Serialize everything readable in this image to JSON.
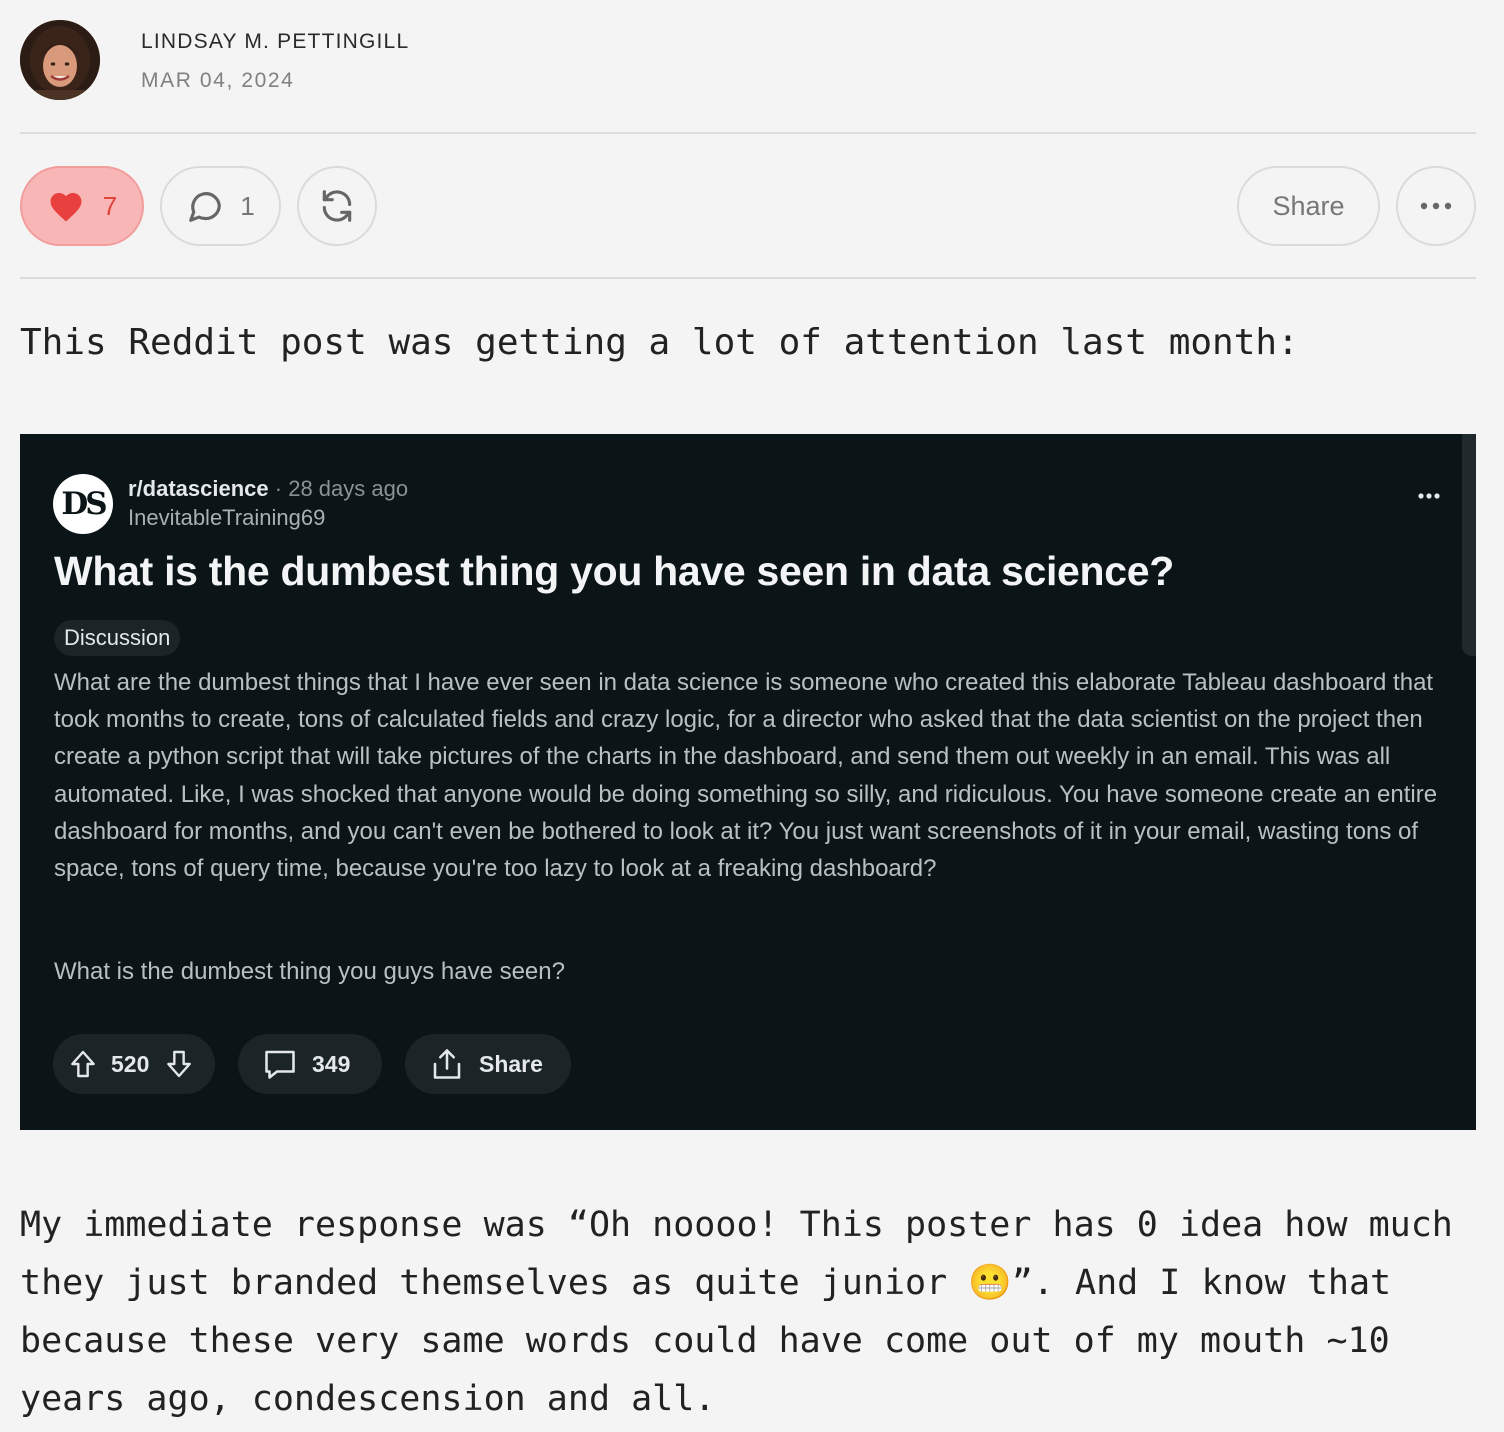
{
  "post": {
    "author": "LINDSAY M. PETTINGILL",
    "date": "MAR 04, 2024"
  },
  "actions": {
    "like_count": "7",
    "comment_count": "1",
    "share_label": "Share",
    "like_color": "#e0453c"
  },
  "content": {
    "intro": "This Reddit post was getting a lot of attention last month:",
    "response": "My immediate response was “Oh noooo! This poster has 0 idea how much they just branded themselves as quite junior 😬”. And I know that because these very same words could have come out of my mouth ~10 years ago, condescension and all."
  },
  "reddit": {
    "logo_text": "DS",
    "subreddit": "r/datascience",
    "separator": "·",
    "age": "28 days ago",
    "username": "InevitableTraining69",
    "title": "What is the dumbest thing you have seen in data science?",
    "flair": "Discussion",
    "body": "What are the dumbest things that I have ever seen in data science is someone who created this elaborate Tableau dashboard that took months to create, tons of calculated fields and crazy logic, for a director who asked that the data scientist on the project then create a python script that will take pictures of the charts in the dashboard, and send them out weekly in an email. This was all automated. Like, I was shocked that anyone would be doing something so silly, and ridiculous. You have someone create an entire dashboard for months, and you can't even be bothered to look at it? You just want screenshots of it in your email, wasting tons of space, tons of query time, because you're too lazy to look at a freaking dashboard?",
    "question": "What is the dumbest thing you guys have seen?",
    "votes": "520",
    "comments": "349",
    "share_label": "Share",
    "background": "#0b1416"
  }
}
